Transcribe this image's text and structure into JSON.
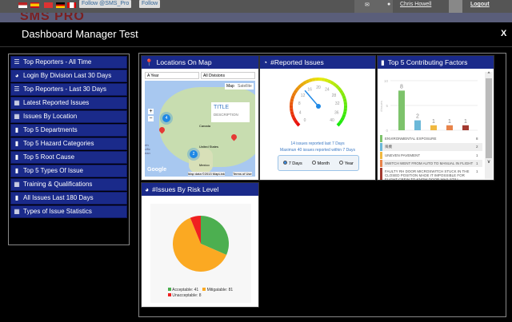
{
  "topbar": {
    "follow_twitter": "Follow @SMS_Pro",
    "follow_linkedin": "Follow",
    "user": "Chris Howell",
    "logout": "Logout"
  },
  "brand": {
    "logo": "SMS PRO"
  },
  "modal": {
    "title": "Dashboard Manager Test",
    "close": "X"
  },
  "sidebar": {
    "items": [
      {
        "label": "Top Reporters - All Time",
        "icon": "bar-h-icon"
      },
      {
        "label": "Login By Division Last 30 Days",
        "icon": "pie-icon"
      },
      {
        "label": "Top Reporters - Last 30 Days",
        "icon": "bar-h-icon"
      },
      {
        "label": "Latest Reported Issues",
        "icon": "table-icon"
      },
      {
        "label": "Issues By Location",
        "icon": "table-icon"
      },
      {
        "label": "Top 5 Departments",
        "icon": "bar-icon"
      },
      {
        "label": "Top 5 Hazard Categories",
        "icon": "bar-icon"
      },
      {
        "label": "Top 5 Root Cause",
        "icon": "bar-icon"
      },
      {
        "label": "Top 5 Types Of Issue",
        "icon": "bar-icon"
      },
      {
        "label": "Training & Qualifications",
        "icon": "table-icon"
      },
      {
        "label": "All Issues Last 180 Days",
        "icon": "bar-icon"
      },
      {
        "label": "Types of Issue Statistics",
        "icon": "table-icon"
      }
    ]
  },
  "map": {
    "title": "Locations On Map",
    "period": "A Year",
    "division": "All Divisions",
    "btn_map": "Map",
    "btn_sat": "Satellite",
    "popup_title": "TITLE",
    "popup_desc": "DESCRIPTION",
    "cluster1": "4",
    "cluster2": "2",
    "labels": {
      "canada": "Canada",
      "us": "United States",
      "mexico": "Mexico",
      "pacific": "rth cific ean"
    },
    "google": "Google",
    "attribution": "Map data ©2013 MapLink",
    "terms": "Terms of Use"
  },
  "gauge": {
    "title": "#Reported Issues",
    "value": 14,
    "max": 40,
    "ticks": [
      "0",
      "4",
      "8",
      "12",
      "16",
      "20",
      "24",
      "28",
      "32",
      "36",
      "40"
    ],
    "line1": "14 issues reported last 7 Days",
    "line2": "Maximun 40 issues reported within 7 Days",
    "options": [
      "7 Days",
      "Month",
      "Year"
    ],
    "selected": "7 Days"
  },
  "factors": {
    "title": "Top 5 Contributing Factors",
    "ylabel": "#Issues",
    "yticks": [
      "0",
      "5",
      "10"
    ],
    "rows": [
      {
        "label": "ENVIRONMENTAL EXPOSURE",
        "value": 8,
        "color": "#7dc36b"
      },
      {
        "label": "風機",
        "value": 2,
        "color": "#6bb8d8"
      },
      {
        "label": "UNEVEN PAVEMENT",
        "value": 1,
        "color": "#f0b840"
      },
      {
        "label": "SWITCH WENT FROM AUTO TO MANUAL IN FLIGHT",
        "value": 1,
        "color": "#e8834a"
      },
      {
        "label": "FAULTY RH DOOR MICROSWITCH STUCK IN THE CLOSED POSITION MADE IT IMPOSSIBLE FOR FLIGHT CREW TO KNOW DOOR WAS STILL",
        "value": 1,
        "color": "#a33a30"
      }
    ]
  },
  "risk": {
    "title": "#Issues By Risk Level",
    "slices": [
      {
        "label": "Acceptable",
        "value": 41,
        "color": "#4caf50"
      },
      {
        "label": "Mitigatable",
        "value": 81,
        "color": "#fba922"
      },
      {
        "label": "Unacceptable",
        "value": 8,
        "color": "#f02020"
      }
    ]
  }
}
